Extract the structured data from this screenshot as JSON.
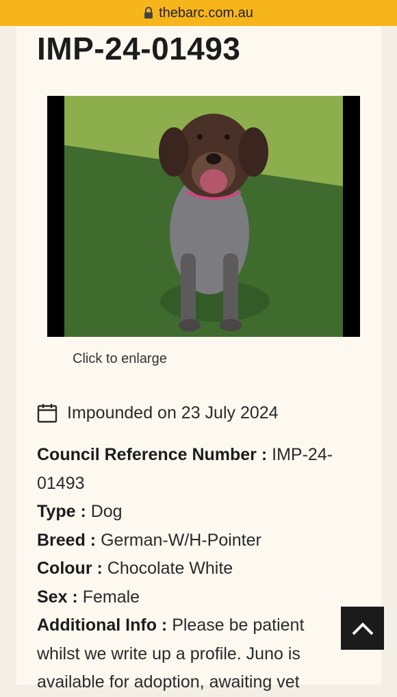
{
  "browser": {
    "url": "thebarc.com.au",
    "lock_icon": "lock-icon"
  },
  "page": {
    "title": "IMP-24-01493",
    "image_caption": "Click to enlarge",
    "impounded_text": "Impounded on 23 July 2024",
    "details": [
      {
        "label": "Council Reference Number :",
        "value": "IMP-24-01493",
        "value_line1": "IMP-24-",
        "value_line2": "01493"
      },
      {
        "label": "Type :",
        "value": "Dog"
      },
      {
        "label": "Breed :",
        "value": "German-W/H-Pointer"
      },
      {
        "label": "Colour :",
        "value": "Chocolate White"
      },
      {
        "label": "Sex :",
        "value": "Female"
      },
      {
        "label": "Additional Info :",
        "value_line1": "Please be patient",
        "value_line2": "whilst we write up a profile. Juno is",
        "value_line3": "available for adoption, awaiting vet"
      }
    ]
  },
  "controls": {
    "scroll_top_icon": "chevron-up-icon"
  },
  "colors": {
    "url_bar": "#f7b51c",
    "card_bg": "#fdf9f1",
    "page_bg": "#f3eee6",
    "scroll_button": "#1b1b1b"
  }
}
